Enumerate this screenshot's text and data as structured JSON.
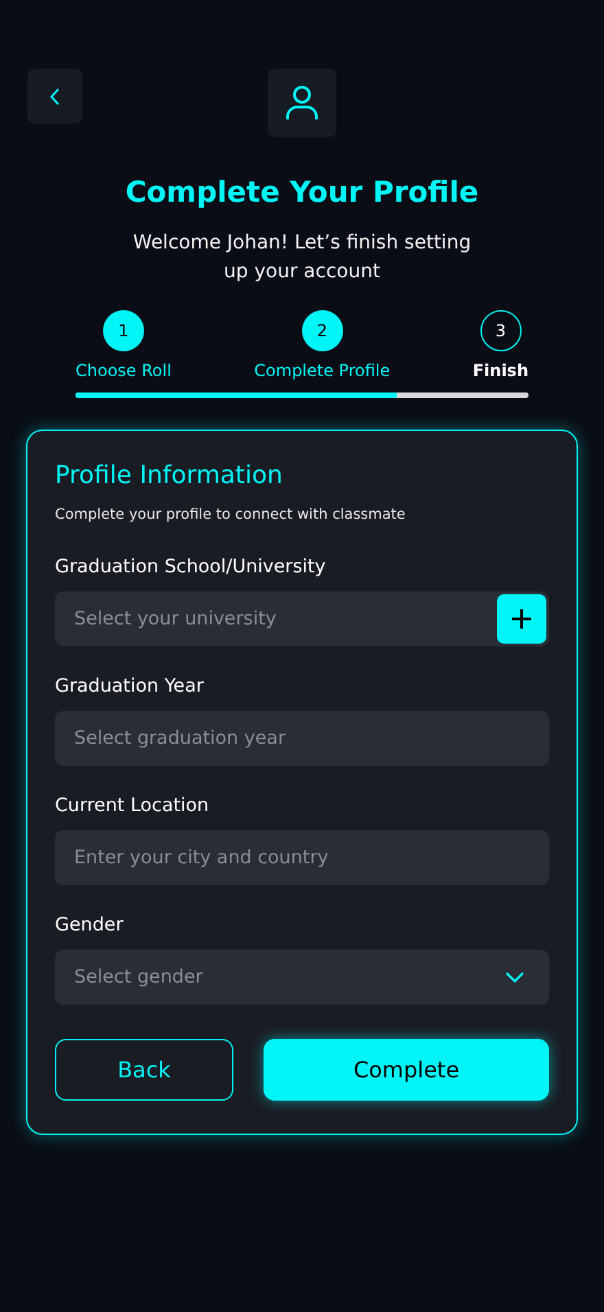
{
  "header": {
    "title": "Complete Your Profile",
    "subtitle": "Welcome Johan! Let’s finish setting up your account"
  },
  "steps": [
    {
      "number": "1",
      "label": "Choose Roll",
      "done": true
    },
    {
      "number": "2",
      "label": "Complete Profile",
      "done": true
    },
    {
      "number": "3",
      "label": "Finish",
      "done": false
    }
  ],
  "progress": {
    "level": 0.71
  },
  "card": {
    "title": "Profile Information",
    "description": "Complete your profile to connect with classmate",
    "fields": [
      {
        "kind": "add",
        "label": "Graduation School/University",
        "placeholder": "Select your university"
      },
      {
        "kind": "text",
        "label": "Graduation Year",
        "placeholder": "Select graduation year"
      },
      {
        "kind": "text",
        "label": "Current Location",
        "placeholder": "Enter your city and country"
      },
      {
        "kind": "select",
        "label": "Gender",
        "placeholder": "Select gender"
      }
    ],
    "buttons": [
      {
        "kind": "secondary",
        "label": "Back"
      },
      {
        "kind": "primary",
        "label": "Complete"
      }
    ]
  }
}
